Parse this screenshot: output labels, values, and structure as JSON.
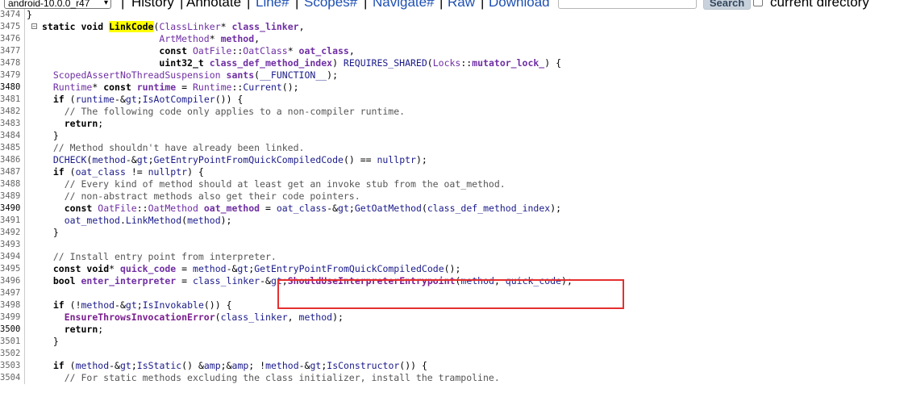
{
  "toolbar": {
    "branch_select": "android-10.0.0_r47",
    "history": "History",
    "annotate": "Annotate",
    "line": "Line#",
    "scopes": "Scopes#",
    "navigate": "Navigate#",
    "raw": "Raw",
    "download": "Download",
    "search_placeholder": "",
    "search_button": "Search",
    "current_directory_label": "current directory"
  },
  "code_lines": [
    {
      "n": "3474",
      "text": "}"
    },
    {
      "n": "3475",
      "text": "static void LinkCode(ClassLinker* class_linker,"
    },
    {
      "n": "3476",
      "text": "                     ArtMethod* method,"
    },
    {
      "n": "3477",
      "text": "                     const OatFile::OatClass* oat_class,"
    },
    {
      "n": "3478",
      "text": "                     uint32_t class_def_method_index) REQUIRES_SHARED(Locks::mutator_lock_) {"
    },
    {
      "n": "3479",
      "text": "  ScopedAssertNoThreadSuspension sants(__FUNCTION__);"
    },
    {
      "n": "3480",
      "text": "  Runtime* const runtime = Runtime::Current();"
    },
    {
      "n": "3481",
      "text": "  if (runtime->IsAotCompiler()) {"
    },
    {
      "n": "3482",
      "text": "    // The following code only applies to a non-compiler runtime."
    },
    {
      "n": "3483",
      "text": "    return;"
    },
    {
      "n": "3484",
      "text": "  }"
    },
    {
      "n": "3485",
      "text": "  // Method shouldn't have already been linked."
    },
    {
      "n": "3486",
      "text": "  DCHECK(method->GetEntryPointFromQuickCompiledCode() == nullptr);"
    },
    {
      "n": "3487",
      "text": "  if (oat_class != nullptr) {"
    },
    {
      "n": "3488",
      "text": "    // Every kind of method should at least get an invoke stub from the oat_method."
    },
    {
      "n": "3489",
      "text": "    // non-abstract methods also get their code pointers."
    },
    {
      "n": "3490",
      "text": "    const OatFile::OatMethod oat_method = oat_class->GetOatMethod(class_def_method_index);"
    },
    {
      "n": "3491",
      "text": "    oat_method.LinkMethod(method);"
    },
    {
      "n": "3492",
      "text": "  }"
    },
    {
      "n": "3493",
      "text": ""
    },
    {
      "n": "3494",
      "text": "  // Install entry point from interpreter."
    },
    {
      "n": "3495",
      "text": "  const void* quick_code = method->GetEntryPointFromQuickCompiledCode();"
    },
    {
      "n": "3496",
      "text": "  bool enter_interpreter = class_linker->ShouldUseInterpreterEntrypoint(method, quick_code);"
    },
    {
      "n": "3497",
      "text": ""
    },
    {
      "n": "3498",
      "text": "  if (!method->IsInvokable()) {"
    },
    {
      "n": "3499",
      "text": "    EnsureThrowsInvocationError(class_linker, method);"
    },
    {
      "n": "3500",
      "text": "    return;"
    },
    {
      "n": "3501",
      "text": "  }"
    },
    {
      "n": "3502",
      "text": ""
    },
    {
      "n": "3503",
      "text": "  if (method->IsStatic() && !method->IsConstructor()) {"
    },
    {
      "n": "3504",
      "text": "    // For static methods excluding the class initializer, install the trampoline."
    }
  ],
  "colors": {
    "highlight": "#ffff00",
    "annotation_box": "#e53030",
    "link": "#1e4fb3"
  },
  "icons": {
    "fold_toggle": "minus-box-icon",
    "select_arrow": "chevron-down-icon"
  }
}
